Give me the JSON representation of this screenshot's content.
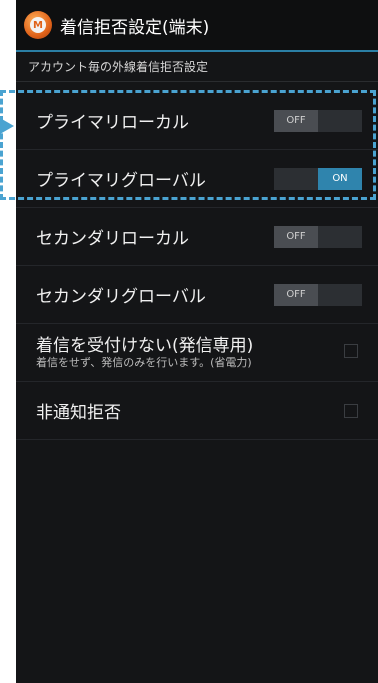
{
  "app": {
    "title": "着信拒否設定(端末)"
  },
  "section": {
    "label": "アカウント毎の外線着信拒否設定"
  },
  "settings": [
    {
      "label": "プライマリローカル",
      "state": "OFF"
    },
    {
      "label": "プライマリグローバル",
      "state": "ON"
    },
    {
      "label": "セカンダリローカル",
      "state": "OFF"
    },
    {
      "label": "セカンダリグローバル",
      "state": "OFF"
    }
  ],
  "outgoing_only": {
    "label": "着信を受付けない(発信専用)",
    "sub": "着信をせず、発信のみを行います。(省電力)",
    "checked": false
  },
  "anonymous_reject": {
    "label": "非通知拒否",
    "checked": false
  },
  "colors": {
    "accent": "#2f84ad",
    "highlight": "#4aa3d1",
    "background": "#141517"
  },
  "icons": {
    "app": "app-logo-icon"
  }
}
